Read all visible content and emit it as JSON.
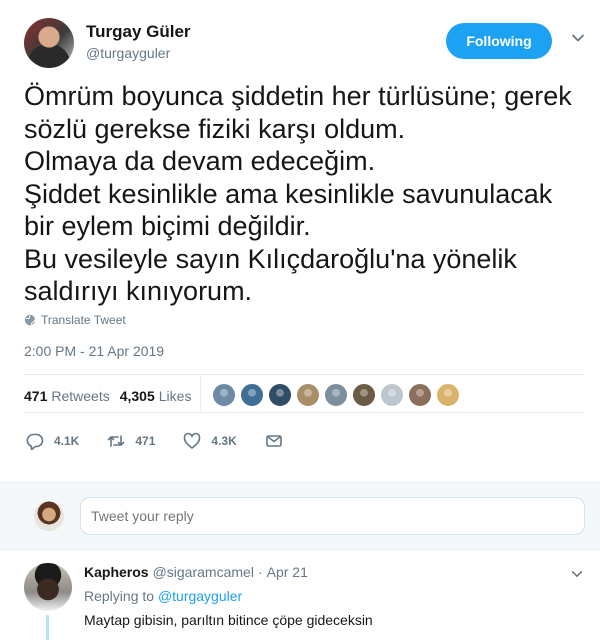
{
  "author": {
    "name": "Turgay Güler",
    "handle": "@turgayguler",
    "follow_label": "Following"
  },
  "tweet": {
    "lines": [
      "Ömrüm boyunca şiddetin her türlüsüne; gerek",
      "sözlü gerekse fiziki karşı oldum.",
      "Olmaya da devam edeceğim.",
      "Şiddet kesinlikle ama kesinlikle savunulacak",
      "bir eylem biçimi değildir.",
      "Bu vesileyle sayın Kılıçdaroğlu'na yönelik",
      "saldırıyı kınıyorum."
    ],
    "translate_label": "Translate Tweet",
    "timestamp": "2:00 PM - 21 Apr 2019"
  },
  "stats": {
    "retweets_count": "471",
    "retweets_label": "Retweets",
    "likes_count": "4,305",
    "likes_label": "Likes",
    "liker_colors": [
      "#6d8aa6",
      "#3f6f95",
      "#2f4d66",
      "#a88f6a",
      "#7d8f9c",
      "#6b5a44",
      "#bcc6cf",
      "#8b6e5c",
      "#d8b36a"
    ]
  },
  "actions": {
    "reply_count": "4.1K",
    "retweet_count": "471",
    "like_count": "4.3K"
  },
  "reply_box": {
    "placeholder": "Tweet your reply"
  },
  "reply": {
    "name": "Kapheros",
    "handle": "@sigaramcamel",
    "separator": "·",
    "date": "Apr 21",
    "replying_prefix": "Replying to",
    "replying_to": "@turgayguler",
    "text": "Maytap gibisin, parıltın bitince çöpe gideceksin"
  },
  "colors": {
    "accent": "#1da1f2",
    "muted": "#657786",
    "text": "#14171a"
  }
}
